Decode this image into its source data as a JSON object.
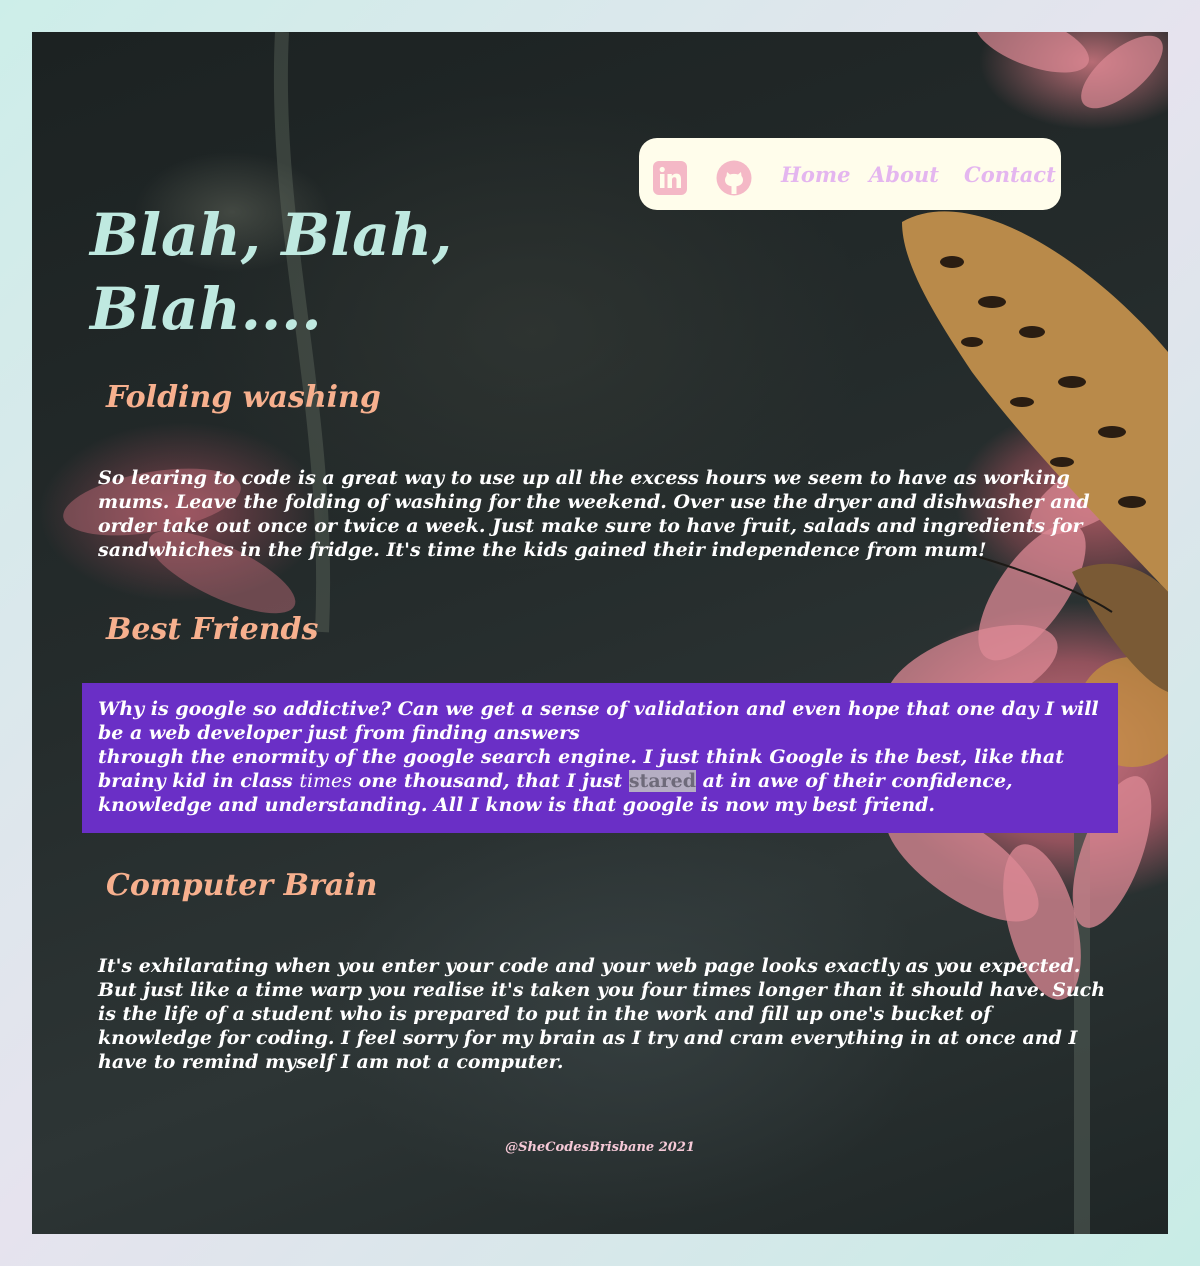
{
  "nav": {
    "linkedin_icon": "linkedin-icon",
    "github_icon": "github-icon",
    "home": "Home",
    "about": "About",
    "contact": "Contact"
  },
  "page_title": "Blah, Blah, Blah....",
  "sections": [
    {
      "heading": "Folding washing",
      "text": "So learing to code is a great way to use up all the excess hours we seem to have as working mums. Leave the folding of washing for the weekend. Over use the dryer and dishwasher and order take out once or twice a week. Just make sure to have fruit, salads and ingredients for sandwhiches in the fridge. It's time the kids gained their independence from mum!"
    },
    {
      "heading": "Best Friends",
      "text_line1": "Why is google so addictive? Can we get a sense of validation and even hope that one day I will be a web developer just from finding answers",
      "text_line2_a": "through the enormity of the google search engine. I just think Google is the best, like that brainy kid in class ",
      "text_em": "times",
      "text_line2_b": " one thousand, that I just ",
      "text_selected": "stared",
      "text_line2_c": " at in awe of their confidence, knowledge and understanding. All I know is that google is now my best friend."
    },
    {
      "heading": "Computer Brain",
      "text": "It's exhilarating when you enter your code and your web page looks exactly as you expected. But just like a time warp you realise it's taken you four times longer than it should have. Such is the life of a student who is prepared to put in the work and fill up one's bucket of knowledge for coding. I feel sorry for my brain as I try and cram everything in at once and I have to remind myself I am not a computer."
    }
  ],
  "footer": "@SheCodesBrisbane 2021",
  "colors": {
    "nav_bg": "#fffdeb",
    "nav_link": "#e4b6ef",
    "icon": "#f4b8c6",
    "title": "#bfe9e0",
    "heading": "#f7b08e",
    "highlight_bg": "#6a2fc6"
  }
}
